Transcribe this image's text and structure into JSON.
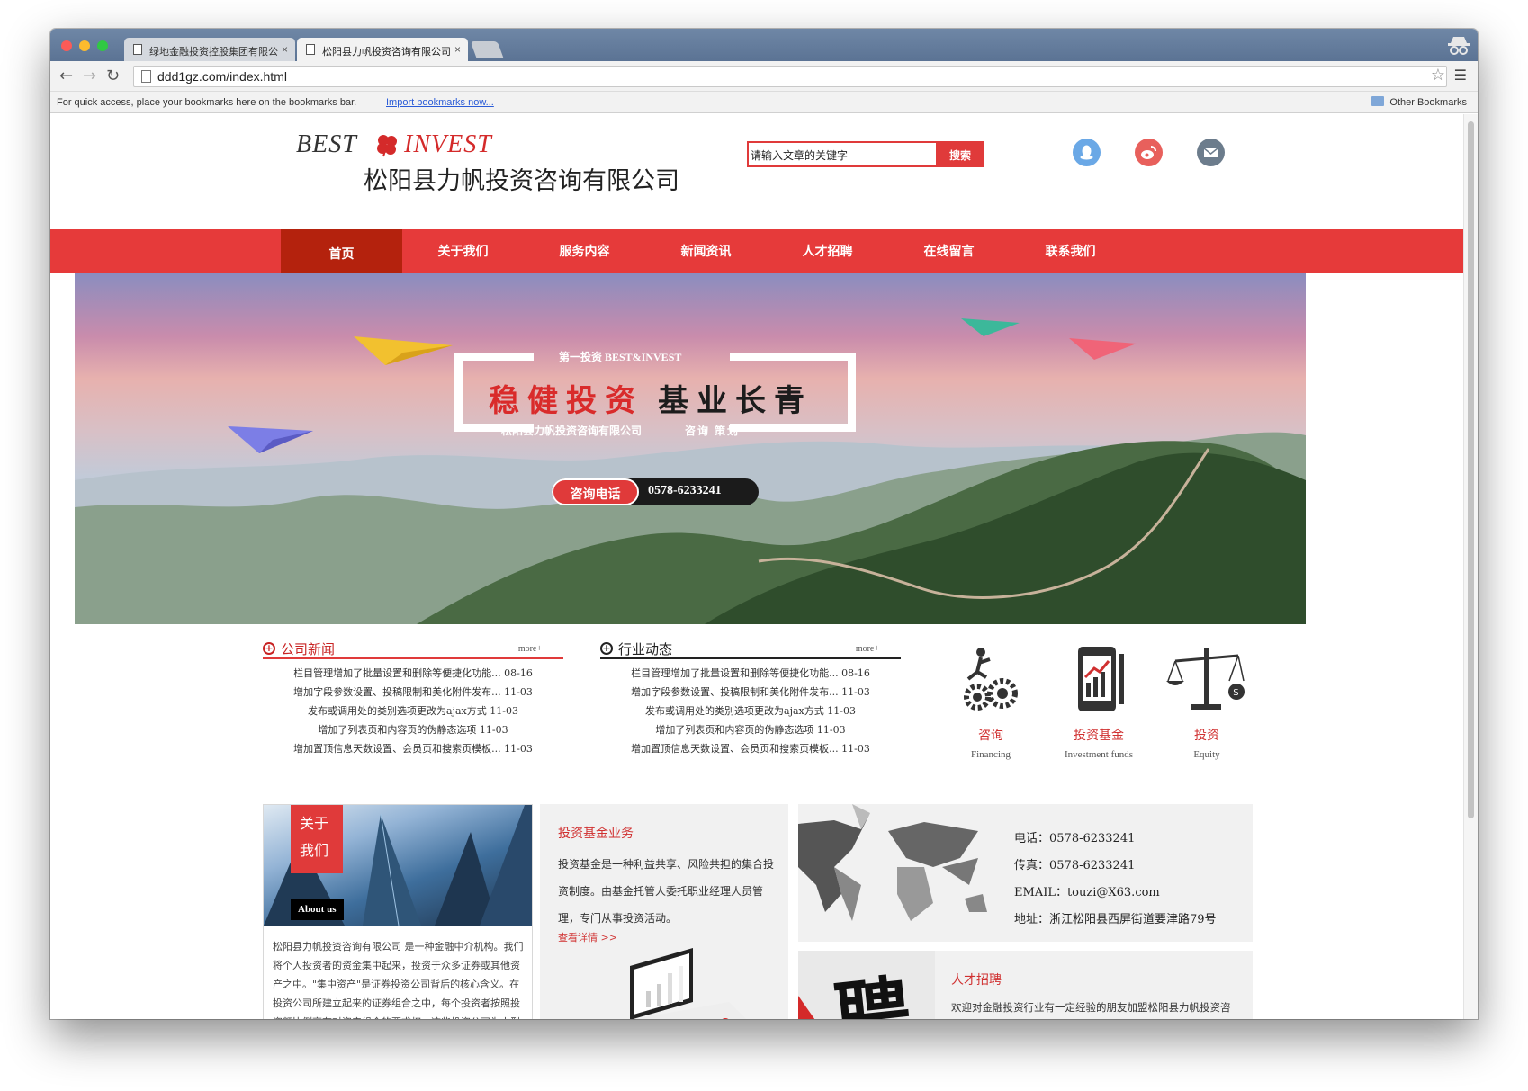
{
  "browser": {
    "tabs": [
      {
        "label": "绿地金融投资控股集团有限公"
      },
      {
        "label": "松阳县力帆投资咨询有限公司"
      }
    ],
    "url": "ddd1gz.com/index.html",
    "bookmarks_message": "For quick access, place your bookmarks here on the bookmarks bar.",
    "import_link": "Import bookmarks now...",
    "other_bookmarks": "Other Bookmarks"
  },
  "header": {
    "logo_best": "BEST",
    "logo_invest": "INVEST",
    "company_name": "松阳县力帆投资咨询有限公司",
    "search_placeholder": "请输入文章的关键字",
    "search_button": "搜索"
  },
  "nav": {
    "items": [
      "首页",
      "关于我们",
      "服务内容",
      "新闻资讯",
      "人才招聘",
      "在线留言",
      "联系我们"
    ],
    "active": "首页"
  },
  "banner": {
    "tagline": "第一投资 BEST&INVEST",
    "slogan_red": "稳健投资",
    "slogan_dark": "基业长青",
    "sub_company": "松阳县力帆投资咨询有限公司",
    "sub_services": "咨询  策划",
    "phone_label": "咨询电话",
    "phone_number": "0578-6233241"
  },
  "news": {
    "company": {
      "title": "公司新闻",
      "more": "more+",
      "items": [
        "栏目管理增加了批量设置和删除等便捷化功能... 08-16",
        "增加字段参数设置、投稿限制和美化附件发布... 11-03",
        "发布或调用处的类别选项更改为ajax方式 11-03",
        "增加了列表页和内容页的伪静态选项 11-03",
        "增加置顶信息天数设置、会员页和搜索页模板... 11-03"
      ]
    },
    "industry": {
      "title": "行业动态",
      "more": "more+",
      "items": [
        "栏目管理增加了批量设置和删除等便捷化功能... 08-16",
        "增加字段参数设置、投稿限制和美化附件发布... 11-03",
        "发布或调用处的类别选项更改为ajax方式 11-03",
        "增加了列表页和内容页的伪静态选项 11-03",
        "增加置顶信息天数设置、会员页和搜索页模板... 11-03"
      ]
    }
  },
  "services": [
    {
      "cn": "咨询",
      "en": "Financing",
      "icon": "gear-runner-icon"
    },
    {
      "cn": "投资基金",
      "en": "Investment funds",
      "icon": "tablet-chart-icon"
    },
    {
      "cn": "投资",
      "en": "Equity",
      "icon": "scale-icon"
    }
  ],
  "about": {
    "tag_line1": "关于",
    "tag_line2": "我们",
    "tag_en": "About us",
    "text": "松阳县力帆投资咨询有限公司 是一种金融中介机构。我们将个人投资者的资金集中起来，投资于众多证券或其他资产之中。\"集中资产\"是证券投资公司背后的核心含义。在投资公司所建立起来的证券组合之中，每个投资者按照投资额比例享有对资产组合的要求权，这些投资公司为小型投资者们提供了这样一"
  },
  "fund": {
    "title": "投资基金业务",
    "text": "投资基金是一种利益共享、风险共担的集合投资制度。由基金托管人委托职业经理人员管理，专门从事投资活动。",
    "link": "查看详情 >>"
  },
  "contact": {
    "phone": "电话：0578-6233241",
    "fax": "传真：0578-6233241",
    "email": "EMAIL：touzi@X63.com",
    "address": "地址：浙江松阳县西屏街道要津路79号"
  },
  "recruit": {
    "char": "聘",
    "title": "人才招聘",
    "text": "欢迎对金融投资行业有一定经验的朋友加盟松阳县力帆投资咨询有限公司，我们给您一个展示才华的舞台与事业腾飞的"
  },
  "colors": {
    "accent_red": "#e63a3a",
    "nav_active": "#b4220d"
  }
}
